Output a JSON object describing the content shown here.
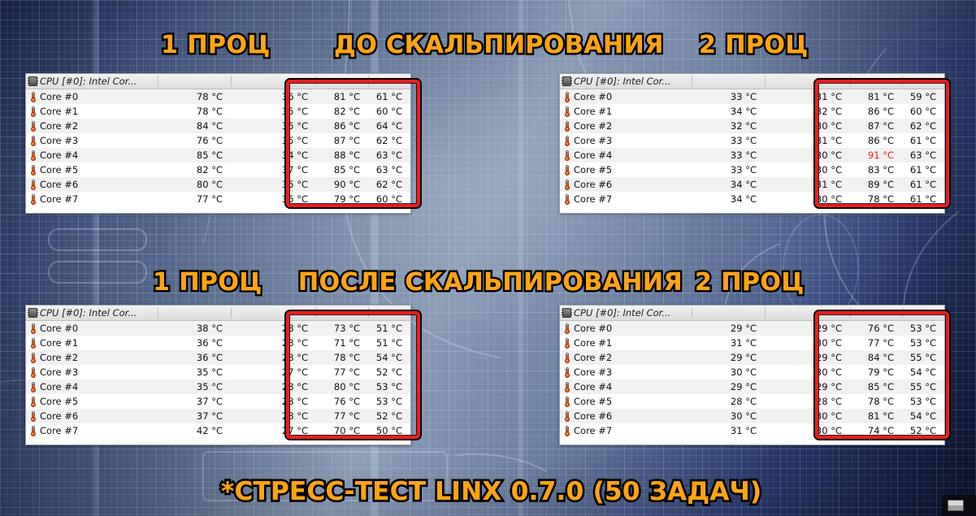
{
  "meta": {
    "background_color": "#5d708f",
    "accent_color": "#FFA412",
    "alarm_color": "#e8251b",
    "highlight_box_color": "#ee1c1c"
  },
  "headings": {
    "top_left": "1 ПРОЦ",
    "top_center": "ДО СКАЛЬПИРОВАНИЯ",
    "top_right": "2 ПРОЦ",
    "mid_left": "1 ПРОЦ",
    "mid_center": "ПОСЛЕ СКАЛЬПИРОВАНИЯ",
    "mid_right": "2 ПРОЦ"
  },
  "caption": "*СТРЕСС-ТЕСТ LINX 0.7.0 (50 ЗАДАЧ)",
  "icons": {
    "cpu": "cpu-chip-icon",
    "sensor": "thermometer-icon"
  },
  "tables": [
    {
      "id": "top-left",
      "position": "top-left",
      "header_title": "CPU [#0]: Intel Cor...",
      "rows": [
        {
          "label": "Core #0",
          "current": "78 °C",
          "minimum": "36 °C",
          "maximum": "81 °C",
          "average": "61 °C",
          "max_alarm": false
        },
        {
          "label": "Core #1",
          "current": "78 °C",
          "minimum": "35 °C",
          "maximum": "82 °C",
          "average": "60 °C",
          "max_alarm": false
        },
        {
          "label": "Core #2",
          "current": "84 °C",
          "minimum": "35 °C",
          "maximum": "86 °C",
          "average": "64 °C",
          "max_alarm": false
        },
        {
          "label": "Core #3",
          "current": "76 °C",
          "minimum": "35 °C",
          "maximum": "87 °C",
          "average": "62 °C",
          "max_alarm": false
        },
        {
          "label": "Core #4",
          "current": "85 °C",
          "minimum": "34 °C",
          "maximum": "88 °C",
          "average": "63 °C",
          "max_alarm": false
        },
        {
          "label": "Core #5",
          "current": "82 °C",
          "minimum": "37 °C",
          "maximum": "85 °C",
          "average": "63 °C",
          "max_alarm": false
        },
        {
          "label": "Core #6",
          "current": "80 °C",
          "minimum": "35 °C",
          "maximum": "90 °C",
          "average": "62 °C",
          "max_alarm": false
        },
        {
          "label": "Core #7",
          "current": "77 °C",
          "minimum": "35 °C",
          "maximum": "79 °C",
          "average": "60 °C",
          "max_alarm": false
        }
      ]
    },
    {
      "id": "top-right",
      "position": "top-right",
      "header_title": "CPU [#0]: Intel Cor...",
      "rows": [
        {
          "label": "Core #0",
          "current": "33 °C",
          "minimum": "31 °C",
          "maximum": "81 °C",
          "average": "59 °C",
          "max_alarm": false
        },
        {
          "label": "Core #1",
          "current": "34 °C",
          "minimum": "32 °C",
          "maximum": "86 °C",
          "average": "60 °C",
          "max_alarm": false
        },
        {
          "label": "Core #2",
          "current": "32 °C",
          "minimum": "30 °C",
          "maximum": "87 °C",
          "average": "62 °C",
          "max_alarm": false
        },
        {
          "label": "Core #3",
          "current": "33 °C",
          "minimum": "31 °C",
          "maximum": "86 °C",
          "average": "61 °C",
          "max_alarm": false
        },
        {
          "label": "Core #4",
          "current": "33 °C",
          "minimum": "30 °C",
          "maximum": "91 °C",
          "average": "63 °C",
          "max_alarm": true
        },
        {
          "label": "Core #5",
          "current": "33 °C",
          "minimum": "30 °C",
          "maximum": "83 °C",
          "average": "61 °C",
          "max_alarm": false
        },
        {
          "label": "Core #6",
          "current": "34 °C",
          "minimum": "31 °C",
          "maximum": "89 °C",
          "average": "61 °C",
          "max_alarm": false
        },
        {
          "label": "Core #7",
          "current": "34 °C",
          "minimum": "30 °C",
          "maximum": "78 °C",
          "average": "61 °C",
          "max_alarm": false
        }
      ]
    },
    {
      "id": "bottom-left",
      "position": "bottom-left",
      "header_title": "CPU [#0]: Intel Cor...",
      "rows": [
        {
          "label": "Core #0",
          "current": "38 °C",
          "minimum": "28 °C",
          "maximum": "73 °C",
          "average": "51 °C",
          "max_alarm": false
        },
        {
          "label": "Core #1",
          "current": "36 °C",
          "minimum": "28 °C",
          "maximum": "71 °C",
          "average": "51 °C",
          "max_alarm": false
        },
        {
          "label": "Core #2",
          "current": "36 °C",
          "minimum": "28 °C",
          "maximum": "78 °C",
          "average": "54 °C",
          "max_alarm": false
        },
        {
          "label": "Core #3",
          "current": "35 °C",
          "minimum": "27 °C",
          "maximum": "77 °C",
          "average": "52 °C",
          "max_alarm": false
        },
        {
          "label": "Core #4",
          "current": "35 °C",
          "minimum": "28 °C",
          "maximum": "80 °C",
          "average": "53 °C",
          "max_alarm": false
        },
        {
          "label": "Core #5",
          "current": "37 °C",
          "minimum": "28 °C",
          "maximum": "76 °C",
          "average": "53 °C",
          "max_alarm": false
        },
        {
          "label": "Core #6",
          "current": "37 °C",
          "minimum": "28 °C",
          "maximum": "77 °C",
          "average": "52 °C",
          "max_alarm": false
        },
        {
          "label": "Core #7",
          "current": "42 °C",
          "minimum": "27 °C",
          "maximum": "70 °C",
          "average": "50 °C",
          "max_alarm": false
        }
      ]
    },
    {
      "id": "bottom-right",
      "position": "bottom-right",
      "header_title": "CPU [#0]: Intel Cor...",
      "rows": [
        {
          "label": "Core #0",
          "current": "29 °C",
          "minimum": "29 °C",
          "maximum": "76 °C",
          "average": "53 °C",
          "max_alarm": false
        },
        {
          "label": "Core #1",
          "current": "31 °C",
          "minimum": "30 °C",
          "maximum": "77 °C",
          "average": "53 °C",
          "max_alarm": false
        },
        {
          "label": "Core #2",
          "current": "29 °C",
          "minimum": "29 °C",
          "maximum": "84 °C",
          "average": "55 °C",
          "max_alarm": false
        },
        {
          "label": "Core #3",
          "current": "30 °C",
          "minimum": "30 °C",
          "maximum": "79 °C",
          "average": "54 °C",
          "max_alarm": false
        },
        {
          "label": "Core #4",
          "current": "29 °C",
          "minimum": "29 °C",
          "maximum": "85 °C",
          "average": "55 °C",
          "max_alarm": false
        },
        {
          "label": "Core #5",
          "current": "28 °C",
          "minimum": "28 °C",
          "maximum": "78 °C",
          "average": "53 °C",
          "max_alarm": false
        },
        {
          "label": "Core #6",
          "current": "30 °C",
          "minimum": "30 °C",
          "maximum": "81 °C",
          "average": "54 °C",
          "max_alarm": false
        },
        {
          "label": "Core #7",
          "current": "31 °C",
          "minimum": "30 °C",
          "maximum": "74 °C",
          "average": "52 °C",
          "max_alarm": false
        }
      ]
    }
  ]
}
